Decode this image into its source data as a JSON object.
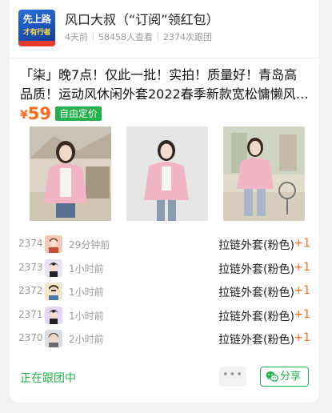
{
  "header": {
    "logo_line1": "先上路",
    "logo_line2": "才有行者",
    "title": "风口大叔（“订阅”领红包）",
    "meta_time": "4天前",
    "meta_views": "58458人查看",
    "meta_follow": "2374次跟团"
  },
  "product": {
    "description": "「柒」晚7点！仅此一批！实拍！质量好！青岛高品质！运动风休闲外套2022春季新款宽松慵懒风拉…",
    "currency": "¥",
    "price": "59",
    "price_tag": "自由定价",
    "photo_alts": [
      "photo-1",
      "photo-2",
      "photo-3"
    ]
  },
  "buyers": [
    {
      "index": "2374",
      "time": "29分钟前",
      "item": "拉链外套(粉色)",
      "qty": "+1"
    },
    {
      "index": "2373",
      "time": "1小时前",
      "item": "拉链外套(粉色)",
      "qty": "+1"
    },
    {
      "index": "2372",
      "time": "1小时前",
      "item": "拉链外套(粉色)",
      "qty": "+1"
    },
    {
      "index": "2371",
      "time": "1小时前",
      "item": "拉链外套(粉色)",
      "qty": "+1"
    },
    {
      "index": "2370",
      "time": "2小时前",
      "item": "拉链外套(粉色)",
      "qty": "+1"
    }
  ],
  "footer": {
    "status": "正在跟团中",
    "more_label": "•••",
    "share_label": "分享"
  },
  "colors": {
    "accent_green": "#22b14c",
    "price_orange": "#ff6b1a",
    "jacket_pink": "#f2b5c6"
  },
  "icons": [
    "logo",
    "more-icon",
    "wechat-icon"
  ]
}
